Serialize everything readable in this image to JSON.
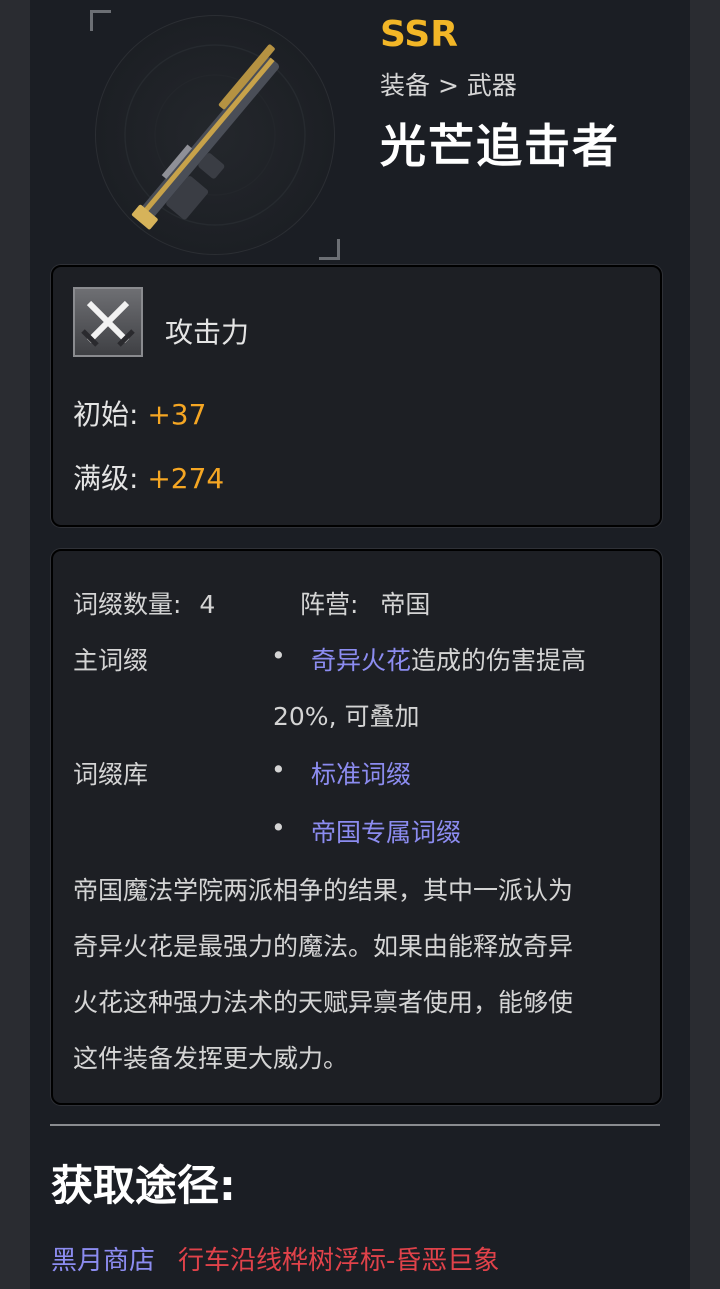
{
  "header": {
    "rarity": "SSR",
    "breadcrumb": "装备 > 武器",
    "title": "光芒追击者"
  },
  "stats": {
    "label": "攻击力",
    "icon": "crossed-swords-icon",
    "initial_label": "初始:",
    "initial_value": "+37",
    "max_label": "满级:",
    "max_value": "+274"
  },
  "affix": {
    "count_label": "词缀数量:",
    "count_value": "4",
    "faction_label": "阵营:",
    "faction_value": "帝国",
    "main_label": "主词缀",
    "main_link": "奇异火花",
    "main_text": "造成的伤害提高",
    "main_text2": "20%, 可叠加",
    "pool_label": "词缀库",
    "pool_items": [
      "标准词缀",
      "帝国专属词缀"
    ],
    "description_lines": [
      "帝国魔法学院两派相争的结果，其中一派认为",
      "奇异火花是最强力的魔法。如果由能释放奇异",
      "火花这种强力法术的天赋异禀者使用，能够使",
      "这件装备发挥更大威力。"
    ]
  },
  "obtain": {
    "title": "获取途径:",
    "source_shop": "黑月商店",
    "source_place": "行车沿线桦树浮标-昏恶巨象"
  },
  "colors": {
    "rarity": "#f2b627",
    "value": "#f5a623",
    "link": "#8c8cf0",
    "place": "#e0424a"
  }
}
